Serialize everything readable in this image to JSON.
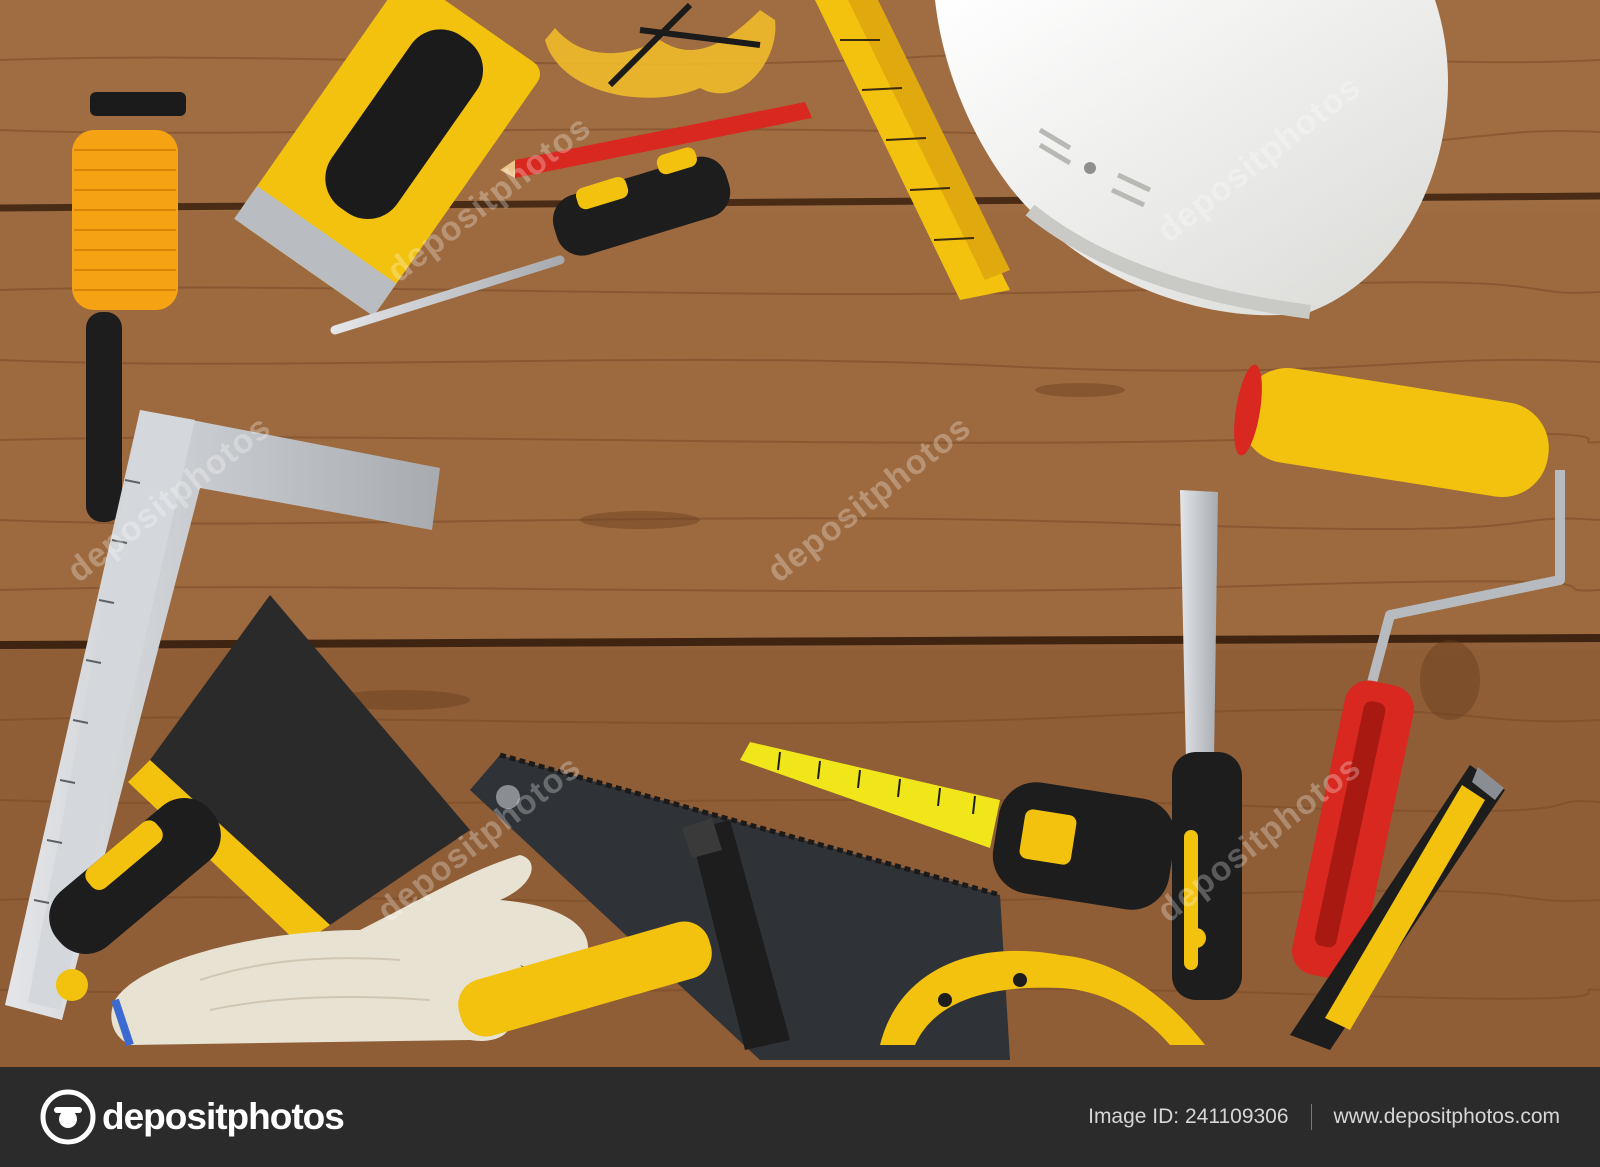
{
  "image": {
    "description": "Flat lay of construction and renovation tools on a rustic wooden table",
    "colors": {
      "wood": "#9a6a40",
      "yellow": "#f2c20f",
      "black": "#1d1d1d",
      "red": "#d8281f",
      "orange": "#f6a313",
      "white": "#f1f1ef",
      "steel": "#c9ccd0"
    },
    "objects": [
      "line-reel-icon",
      "sanding-block-icon",
      "safety-glasses-icon",
      "pencil-icon",
      "screwdriver-icon",
      "folding-ruler-icon",
      "hard-hat-icon",
      "paint-roller-icon",
      "try-square-icon",
      "putty-knife-icon",
      "hand-saw-icon",
      "tape-measure-icon",
      "chisel-icon",
      "work-glove-icon",
      "hammer-icon",
      "utility-knife-icon"
    ]
  },
  "watermark": {
    "text": "depositphotos"
  },
  "footer": {
    "brand_name": "depositphotos",
    "image_id": "Image ID: 241109306",
    "website": "www.depositphotos.com"
  }
}
